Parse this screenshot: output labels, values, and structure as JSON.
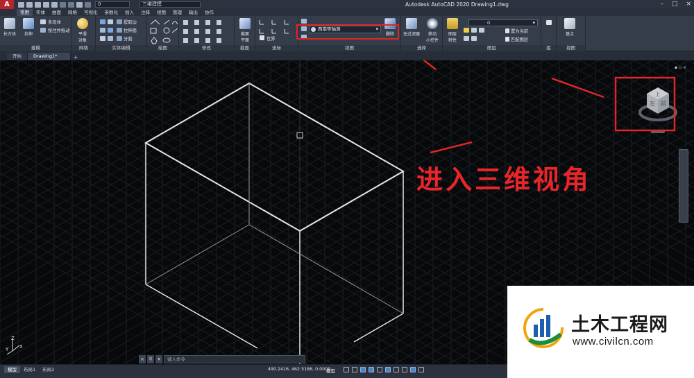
{
  "titlebar": {
    "app_title": "Autodesk AutoCAD 2020    Drawing1.dwg",
    "layer_value": "0",
    "workspace": "三维建模",
    "logo_letter": "A"
  },
  "ribbon_tabs": [
    "常用",
    "实体",
    "曲面",
    "网格",
    "可视化",
    "参数化",
    "插入",
    "注释",
    "视图",
    "管理",
    "输出",
    "协作"
  ],
  "ribbon": {
    "modeling": {
      "title": "建模",
      "box_label": "长方体",
      "extrude_label": "拉伸",
      "polysolid_label": "多段体",
      "presspull_label": "按住并拖动"
    },
    "mesh": {
      "title": "网格",
      "smooth_label": "平滑\n对象"
    },
    "solid_edit": {
      "title": "实体编辑",
      "extract_label": "提取边",
      "extrude_face_label": "拉伸面",
      "separate_label": "分割"
    },
    "draw": {
      "title": "绘图"
    },
    "modify": {
      "title": "修改"
    },
    "section": {
      "title": "截面",
      "section_plane_label": "截面\n平面"
    },
    "coordinates": {
      "title": "坐标",
      "world_label": "世界"
    },
    "view": {
      "title": "视图",
      "view_dropdown": "西南等轴测",
      "delete_label": "删除"
    },
    "selection": {
      "title": "选择",
      "no_filter_label": "无过滤器",
      "move_gizmo_label": "移动\n小控件"
    },
    "layers": {
      "title": "图层",
      "layer_props_label": "图层\n特性",
      "layer_value": "0",
      "set_current_label": "置为当前",
      "match_layer_label": "匹配图层"
    },
    "groups": {
      "title": "组"
    },
    "view2": {
      "title": "视图",
      "base_label": "基点"
    }
  },
  "doc_tabs": {
    "start": "开始",
    "drawing": "Drawing1*",
    "plus": "+"
  },
  "viewport": {
    "controls": "▪ ▫ ×",
    "annotation": "进入三维视角"
  },
  "viewcube": {
    "face_top": "上",
    "face_left": "左",
    "face_front": "前"
  },
  "ucs": {
    "x": "X",
    "y": "Y",
    "z": "Z"
  },
  "cmdline": {
    "placeholder": "键入命令"
  },
  "statusbar": {
    "layout_tabs": [
      "模型",
      "布局1",
      "布局2"
    ],
    "coords": "490.2416, 462.5186, 0.0000",
    "model": "模型"
  },
  "watermark": {
    "name": "土木工程网",
    "url": "www.civilcn.com"
  },
  "colors": {
    "highlight_red": "#e02626",
    "titlebar": "#2c3340",
    "ribbon": "#353d4b",
    "viewport_bg": "#08090b",
    "grid": "#1a1e25",
    "cube_edges": "#e6e6e6"
  }
}
